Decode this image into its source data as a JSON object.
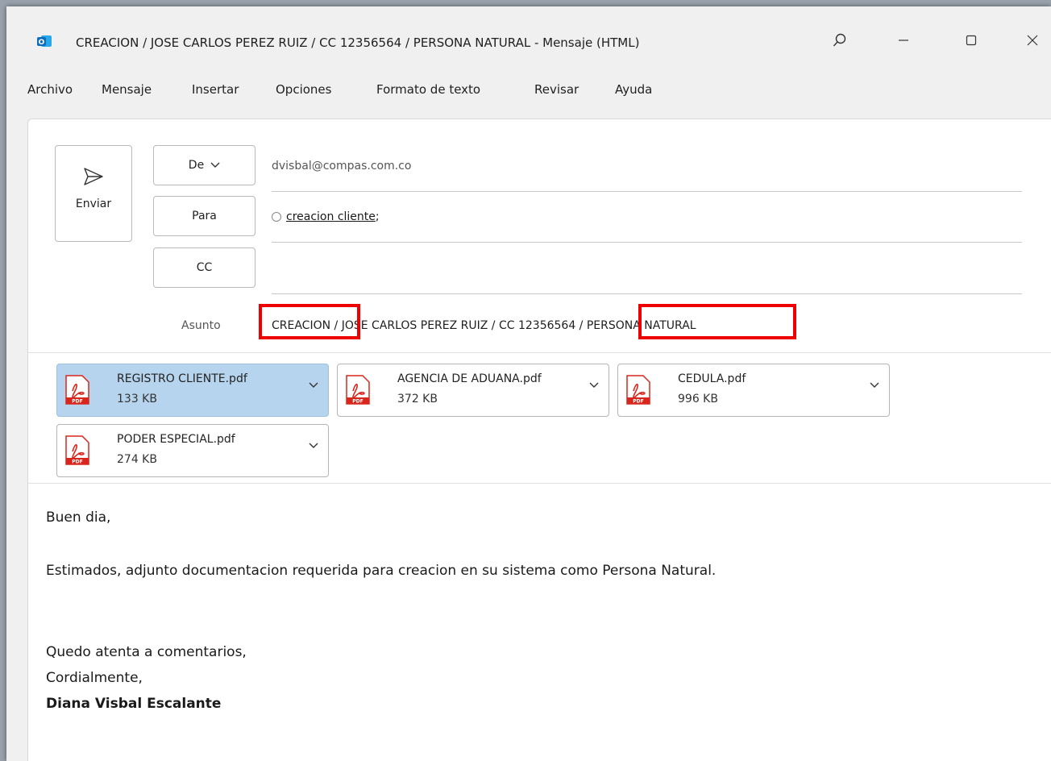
{
  "window": {
    "title": "CREACION / JOSE CARLOS PEREZ RUIZ / CC 12356564 / PERSONA NATURAL  -  Mensaje (HTML)"
  },
  "menu": [
    "Archivo",
    "Mensaje",
    "Insertar",
    "Opciones",
    "Formato de texto",
    "Revisar",
    "Ayuda"
  ],
  "compose": {
    "send_label": "Enviar",
    "from_label": "De",
    "from_value": "dvisbal@compas.com.co",
    "to_label": "Para",
    "to_recipient": "creacion cliente",
    "to_separator": ";",
    "cc_label": "CC",
    "subject_label": "Asunto",
    "subject_value": "CREACION / JOSE CARLOS PEREZ RUIZ / CC 12356564 / PERSONA NATURAL"
  },
  "attachments": [
    {
      "name": "REGISTRO CLIENTE.pdf",
      "size": "133 KB",
      "selected": true
    },
    {
      "name": "AGENCIA DE ADUANA.pdf",
      "size": "372 KB",
      "selected": false
    },
    {
      "name": "CEDULA.pdf",
      "size": "996 KB",
      "selected": false
    },
    {
      "name": "PODER ESPECIAL.pdf",
      "size": "274 KB",
      "selected": false
    }
  ],
  "body": {
    "greeting": "Buen dia,",
    "paragraph": "Estimados, adjunto documentacion requerida para creacion en su sistema como Persona Natural.",
    "closing1": "Quedo atenta a comentarios,",
    "closing2": "Cordialmente,",
    "signature": "Diana Visbal Escalante"
  },
  "colors": {
    "outlook_blue": "#0f6cbd",
    "selected_attachment": "#b6d4ee",
    "highlight_red": "#e00000",
    "pdf_red": "#d9261c"
  }
}
